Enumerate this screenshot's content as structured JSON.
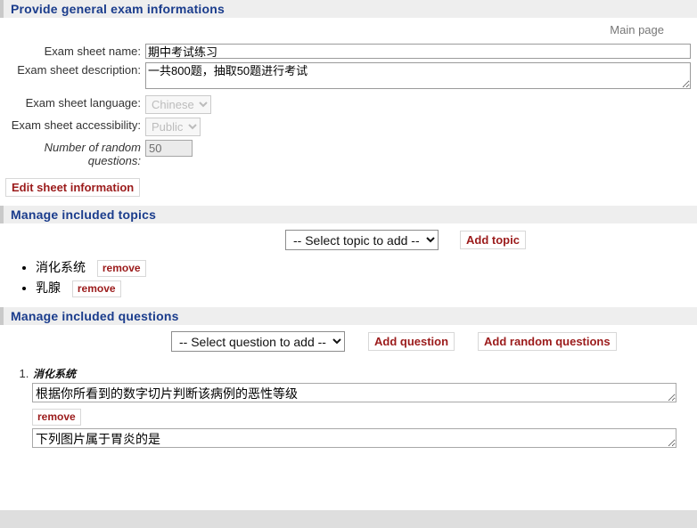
{
  "sections": {
    "general": {
      "title": "Provide general exam informations"
    },
    "topics": {
      "title": "Manage included topics"
    },
    "questions": {
      "title": "Manage included questions"
    }
  },
  "nav": {
    "main_page": "Main page"
  },
  "form": {
    "name_label": "Exam sheet name:",
    "name_value": "期中考试练习",
    "description_label": "Exam sheet description:",
    "description_value": "一共800题，抽取50题进行考试",
    "language_label": "Exam sheet language:",
    "language_value": "Chinese",
    "accessibility_label": "Exam sheet accessibility:",
    "accessibility_value": "Public",
    "random_label": "Number of random questions:",
    "random_value": "50",
    "edit_button": "Edit sheet information"
  },
  "topics_panel": {
    "select_placeholder": "-- Select topic to add --",
    "add_button": "Add topic",
    "items": [
      {
        "name": "消化系统",
        "remove_label": "remove"
      },
      {
        "name": "乳腺",
        "remove_label": "remove"
      }
    ]
  },
  "questions_panel": {
    "select_placeholder": "-- Select question to add --",
    "add_button": "Add question",
    "add_random_button": "Add random questions",
    "items": [
      {
        "topic": "消化系统",
        "text": "根据你所看到的数字切片判断该病例的恶性等级",
        "remove_label": "remove"
      },
      {
        "topic": "",
        "text": "下列图片属于胃炎的是",
        "remove_label": "remove"
      }
    ]
  },
  "colors": {
    "heading": "#1a3c8c",
    "action": "#9b1b1b",
    "bar": "#eeeeee",
    "footer": "#dedede"
  }
}
